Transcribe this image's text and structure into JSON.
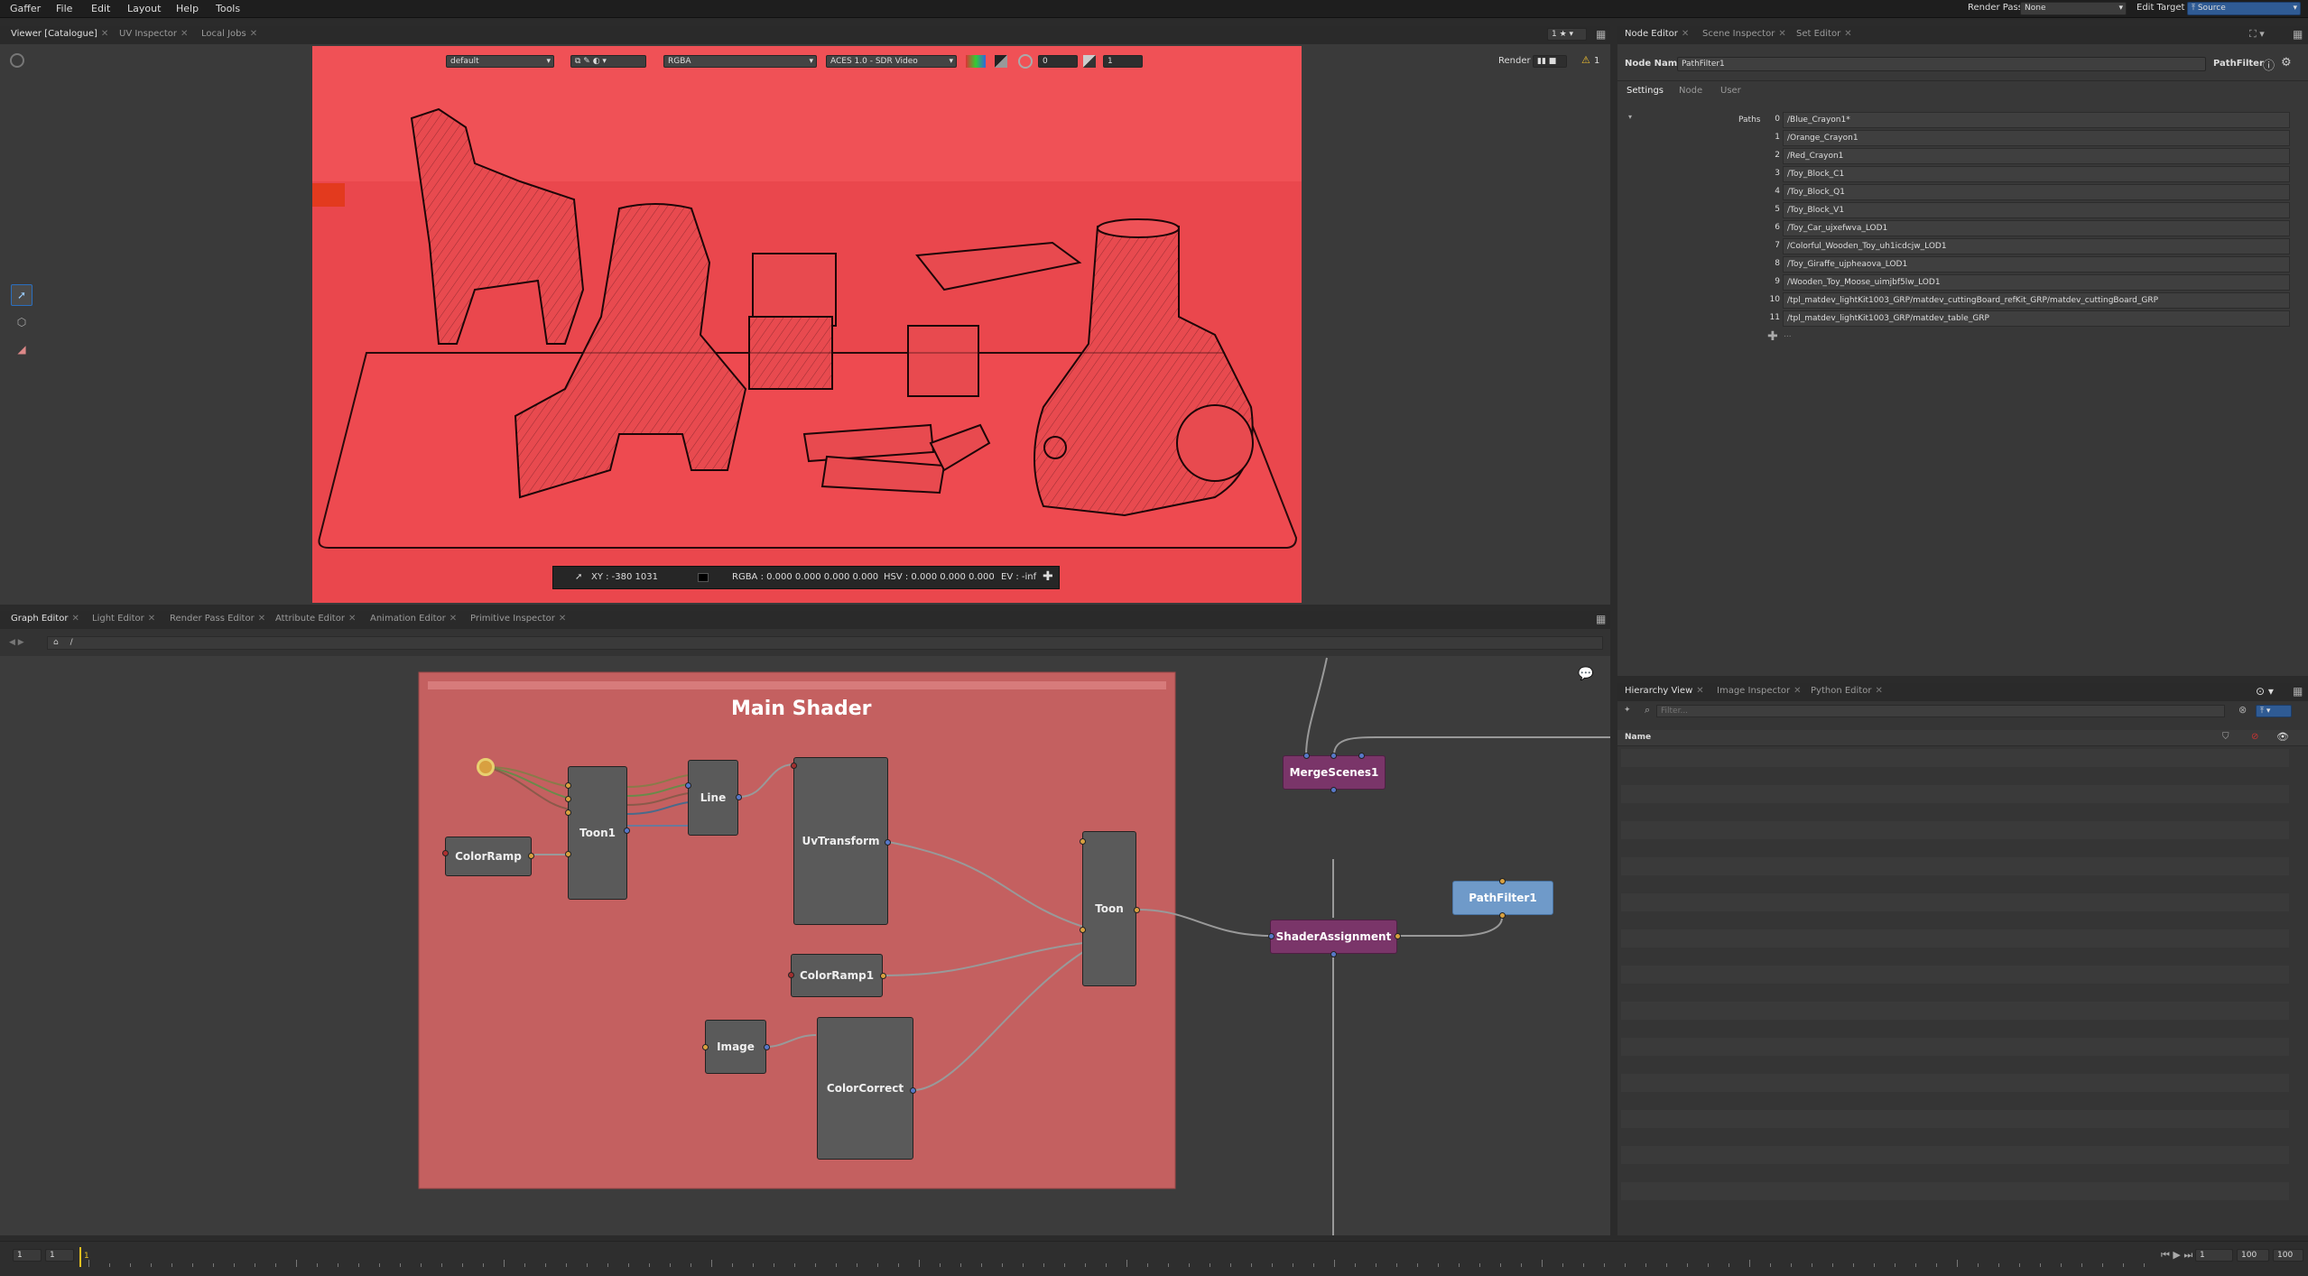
{
  "menubar": {
    "items": [
      "Gaffer",
      "File",
      "Edit",
      "Layout",
      "Help",
      "Tools"
    ],
    "render_pass_label": "Render Pass",
    "render_pass_value": "None",
    "edit_target_label": "Edit Target",
    "edit_target_value": "Source"
  },
  "viewer_tabs": [
    {
      "label": "Viewer [Catalogue]",
      "active": true
    },
    {
      "label": "UV Inspector",
      "active": false
    },
    {
      "label": "Local Jobs",
      "active": false
    }
  ],
  "viewer_tab_right": "1",
  "viewer_toolbar": {
    "display": "default",
    "channels": "RGBA",
    "colorspace": "ACES 1.0 - SDR Video",
    "exposure": "0",
    "gamma": "1",
    "render_label": "Render",
    "warning_count": "1"
  },
  "viewer_status": {
    "xy": "XY : -380 1031",
    "rgba": "RGBA : 0.000 0.000 0.000 0.000",
    "hsv": "HSV : 0.000 0.000 0.000",
    "ev": "EV : -inf"
  },
  "node_editor_tabs": [
    {
      "label": "Node Editor",
      "active": true
    },
    {
      "label": "Scene Inspector",
      "active": false
    },
    {
      "label": "Set Editor",
      "active": false
    }
  ],
  "node_editor": {
    "name_label": "Node Name",
    "name_value": "PathFilter1",
    "type_label": "PathFilter",
    "sections": [
      "Settings",
      "Node",
      "User"
    ],
    "paths_label": "Paths",
    "paths": [
      "/Blue_Crayon1*",
      "/Orange_Crayon1",
      "/Red_Crayon1",
      "/Toy_Block_C1",
      "/Toy_Block_Q1",
      "/Toy_Block_V1",
      "/Toy_Car_ujxefwva_LOD1",
      "/Colorful_Wooden_Toy_uh1icdcjw_LOD1",
      "/Toy_Giraffe_ujpheaova_LOD1",
      "/Wooden_Toy_Moose_uimjbf5lw_LOD1",
      "/tpl_matdev_lightKit1003_GRP/matdev_cuttingBoard_refKit_GRP/matdev_cuttingBoard_GRP",
      "/tpl_matdev_lightKit1003_GRP/matdev_table_GRP"
    ],
    "path_indices": [
      "0",
      "1",
      "2",
      "3",
      "4",
      "5",
      "6",
      "7",
      "8",
      "9",
      "10",
      "11"
    ],
    "more": "..."
  },
  "graph_tabs": [
    {
      "label": "Graph Editor",
      "active": true
    },
    {
      "label": "Light Editor",
      "active": false
    },
    {
      "label": "Render Pass Editor",
      "active": false
    },
    {
      "label": "Attribute Editor",
      "active": false
    },
    {
      "label": "Animation Editor",
      "active": false
    },
    {
      "label": "Primitive Inspector",
      "active": false
    }
  ],
  "graph": {
    "breadcrumb": "/",
    "backdrop_title": "Main Shader",
    "nodes": {
      "colorramp": "ColorRamp",
      "toon1": "Toon1",
      "line": "Line",
      "uvtransform": "UvTransform",
      "colorramp1": "ColorRamp1",
      "image": "Image",
      "colorcorrect": "ColorCorrect",
      "toon": "Toon",
      "mergescenes": "MergeScenes1",
      "shaderassignment": "ShaderAssignment",
      "pathfilter": "PathFilter1"
    },
    "colors": {
      "backdrop": "#c46060",
      "scene_node": "#7a3569",
      "filter_node": "#6f9ac9"
    }
  },
  "hierarchy_tabs": [
    {
      "label": "Hierarchy View",
      "active": true
    },
    {
      "label": "Image Inspector",
      "active": false
    },
    {
      "label": "Python Editor",
      "active": false
    }
  ],
  "hierarchy": {
    "filter_placeholder": "Filter...",
    "name_header": "Name"
  },
  "timeline": {
    "start": "1",
    "start2": "1",
    "current": "1",
    "frame": "1",
    "end": "100",
    "end2": "100"
  }
}
